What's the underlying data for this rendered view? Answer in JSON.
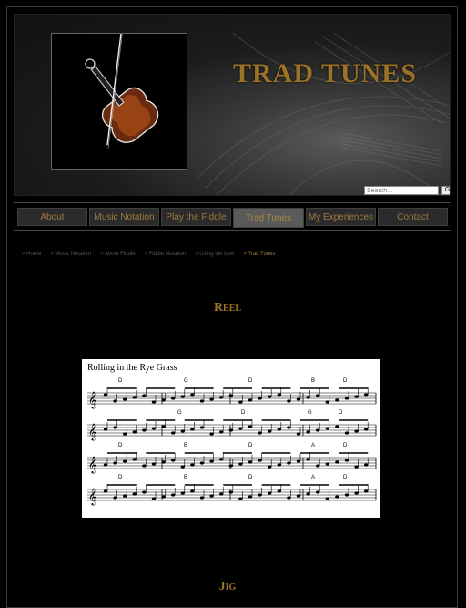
{
  "header": {
    "site_title": "TRAD TUNES",
    "search_placeholder": "Search...",
    "search_button": "Go"
  },
  "nav": [
    {
      "label": "About"
    },
    {
      "label": "Music Notation"
    },
    {
      "label": "Play the Fiddle"
    },
    {
      "label": "Trad Tunes",
      "active": true
    },
    {
      "label": "My Experiences"
    },
    {
      "label": "Contact"
    }
  ],
  "breadcrumb": [
    "> Home",
    "> Music Notation",
    "> About Fiddle",
    "> Fiddle Notation",
    "> Using the bow",
    "> Trad Tunes"
  ],
  "sections": {
    "reel_title": "Reel",
    "jig_title": "Jig"
  },
  "sheet_music": {
    "title": "Rolling in the Rye Grass",
    "chords": [
      [
        "D",
        "G",
        "D",
        "B",
        "D"
      ],
      [
        "G",
        "D",
        "G",
        "D"
      ],
      [
        "D",
        "B",
        "D",
        "A",
        "D"
      ],
      [
        "D",
        "B",
        "D",
        "A",
        "D"
      ]
    ]
  },
  "colors": {
    "accent": "#9c7226",
    "background": "#000000",
    "nav_bg": "#2b2b2b"
  }
}
